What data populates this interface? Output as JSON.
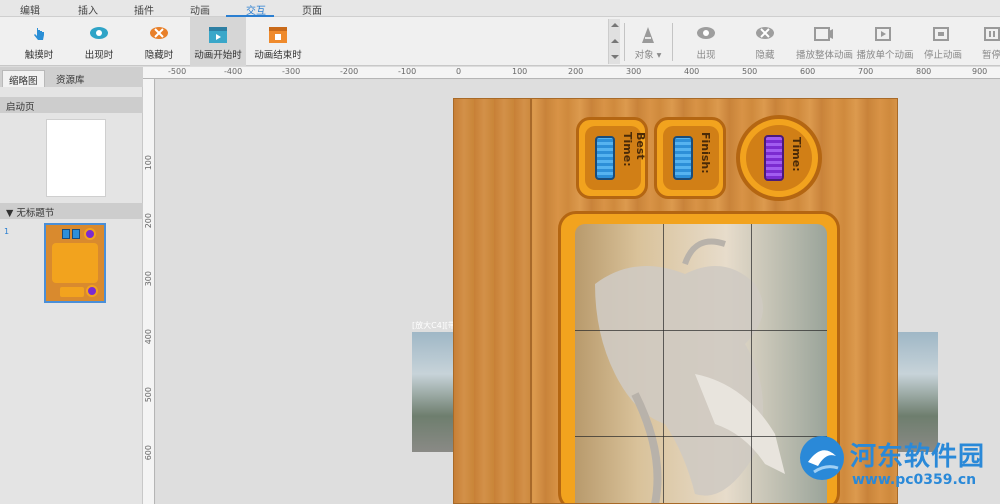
{
  "menu_tabs": [
    "编辑",
    "插入",
    "插件",
    "动画",
    "交互",
    "页面"
  ],
  "active_tab": "交互",
  "ribbon": {
    "trigger_buttons": [
      {
        "label": "触摸时",
        "icon": "touch-icon"
      },
      {
        "label": "出现时",
        "icon": "eye-icon"
      },
      {
        "label": "隐藏时",
        "icon": "eye-hidden-icon"
      },
      {
        "label": "动画开始时",
        "icon": "animation-start-icon"
      },
      {
        "label": "动画结束时",
        "icon": "animation-end-icon"
      }
    ],
    "object_label": "对象",
    "action_buttons": [
      {
        "label": "出现",
        "icon": "eye-icon"
      },
      {
        "label": "隐藏",
        "icon": "eye-hidden-icon"
      },
      {
        "label": "播放整体动画",
        "icon": "play-all-icon"
      },
      {
        "label": "播放单个动画",
        "icon": "play-single-icon"
      },
      {
        "label": "停止动画",
        "icon": "stop-animation-icon"
      },
      {
        "label": "暂停",
        "icon": "pause-icon"
      }
    ]
  },
  "left_panel": {
    "tabs": [
      "缩略图",
      "资源库"
    ],
    "active_tab": "缩略图",
    "start_page_label": "启动页",
    "section_label": "无标题节",
    "page_number": "1"
  },
  "ruler": {
    "h_ticks": [
      "-500",
      "-400",
      "-300",
      "-200",
      "-100",
      "0",
      "100",
      "200",
      "300",
      "400",
      "500",
      "600",
      "700",
      "800",
      "900",
      "100"
    ],
    "v_ticks": [
      "100",
      "200",
      "300",
      "400",
      "500",
      "600"
    ]
  },
  "stage": {
    "labels": [
      "Best Time:",
      "Finish:",
      "Time:"
    ],
    "side_caption": "[放大C4][带…"
  },
  "watermark": {
    "title": "河东软件园",
    "url": "www.pc0359.cn"
  },
  "colors": {
    "accent": "#2b7fd1",
    "wood": "#d38e40",
    "hud_orange": "#f2a31e"
  }
}
